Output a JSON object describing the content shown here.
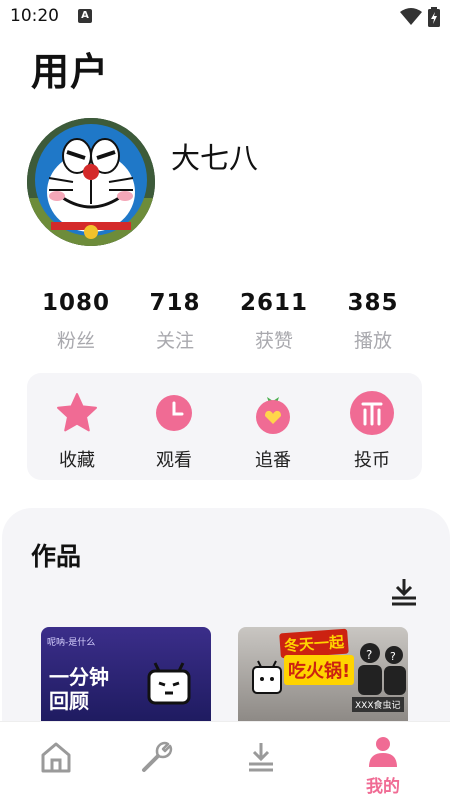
{
  "status": {
    "time": "10:20",
    "notification_glyph": "A"
  },
  "header": {
    "title": "用户"
  },
  "profile": {
    "username": "大七八"
  },
  "stats": [
    {
      "value": "1080",
      "label": "粉丝"
    },
    {
      "value": "718",
      "label": "关注"
    },
    {
      "value": "2611",
      "label": "获赞"
    },
    {
      "value": "385",
      "label": "播放"
    }
  ],
  "quick_actions": [
    {
      "label": "收藏",
      "icon": "star-icon"
    },
    {
      "label": "观看",
      "icon": "clock-icon"
    },
    {
      "label": "追番",
      "icon": "tomato-heart-icon"
    },
    {
      "label": "投币",
      "icon": "coin-icon"
    }
  ],
  "works": {
    "title": "作品",
    "items": [
      {
        "top_text": "呢呐-是什么",
        "headline_1": "一分钟",
        "headline_2": "回顾"
      },
      {
        "banner": "冬天一起",
        "headline": "吃火锅!",
        "caption": "XXX食虫记"
      }
    ]
  },
  "tabbar": {
    "items": [
      {
        "icon": "home-icon",
        "label": ""
      },
      {
        "icon": "wrench-icon",
        "label": ""
      },
      {
        "icon": "download-icon",
        "label": ""
      },
      {
        "icon": "person-icon",
        "label": "我的",
        "active": true
      }
    ]
  },
  "colors": {
    "accent": "#f06b94",
    "panel": "#f5f5f8",
    "muted_text": "#a9a9ae",
    "inactive_icon": "#9a9a9a"
  }
}
